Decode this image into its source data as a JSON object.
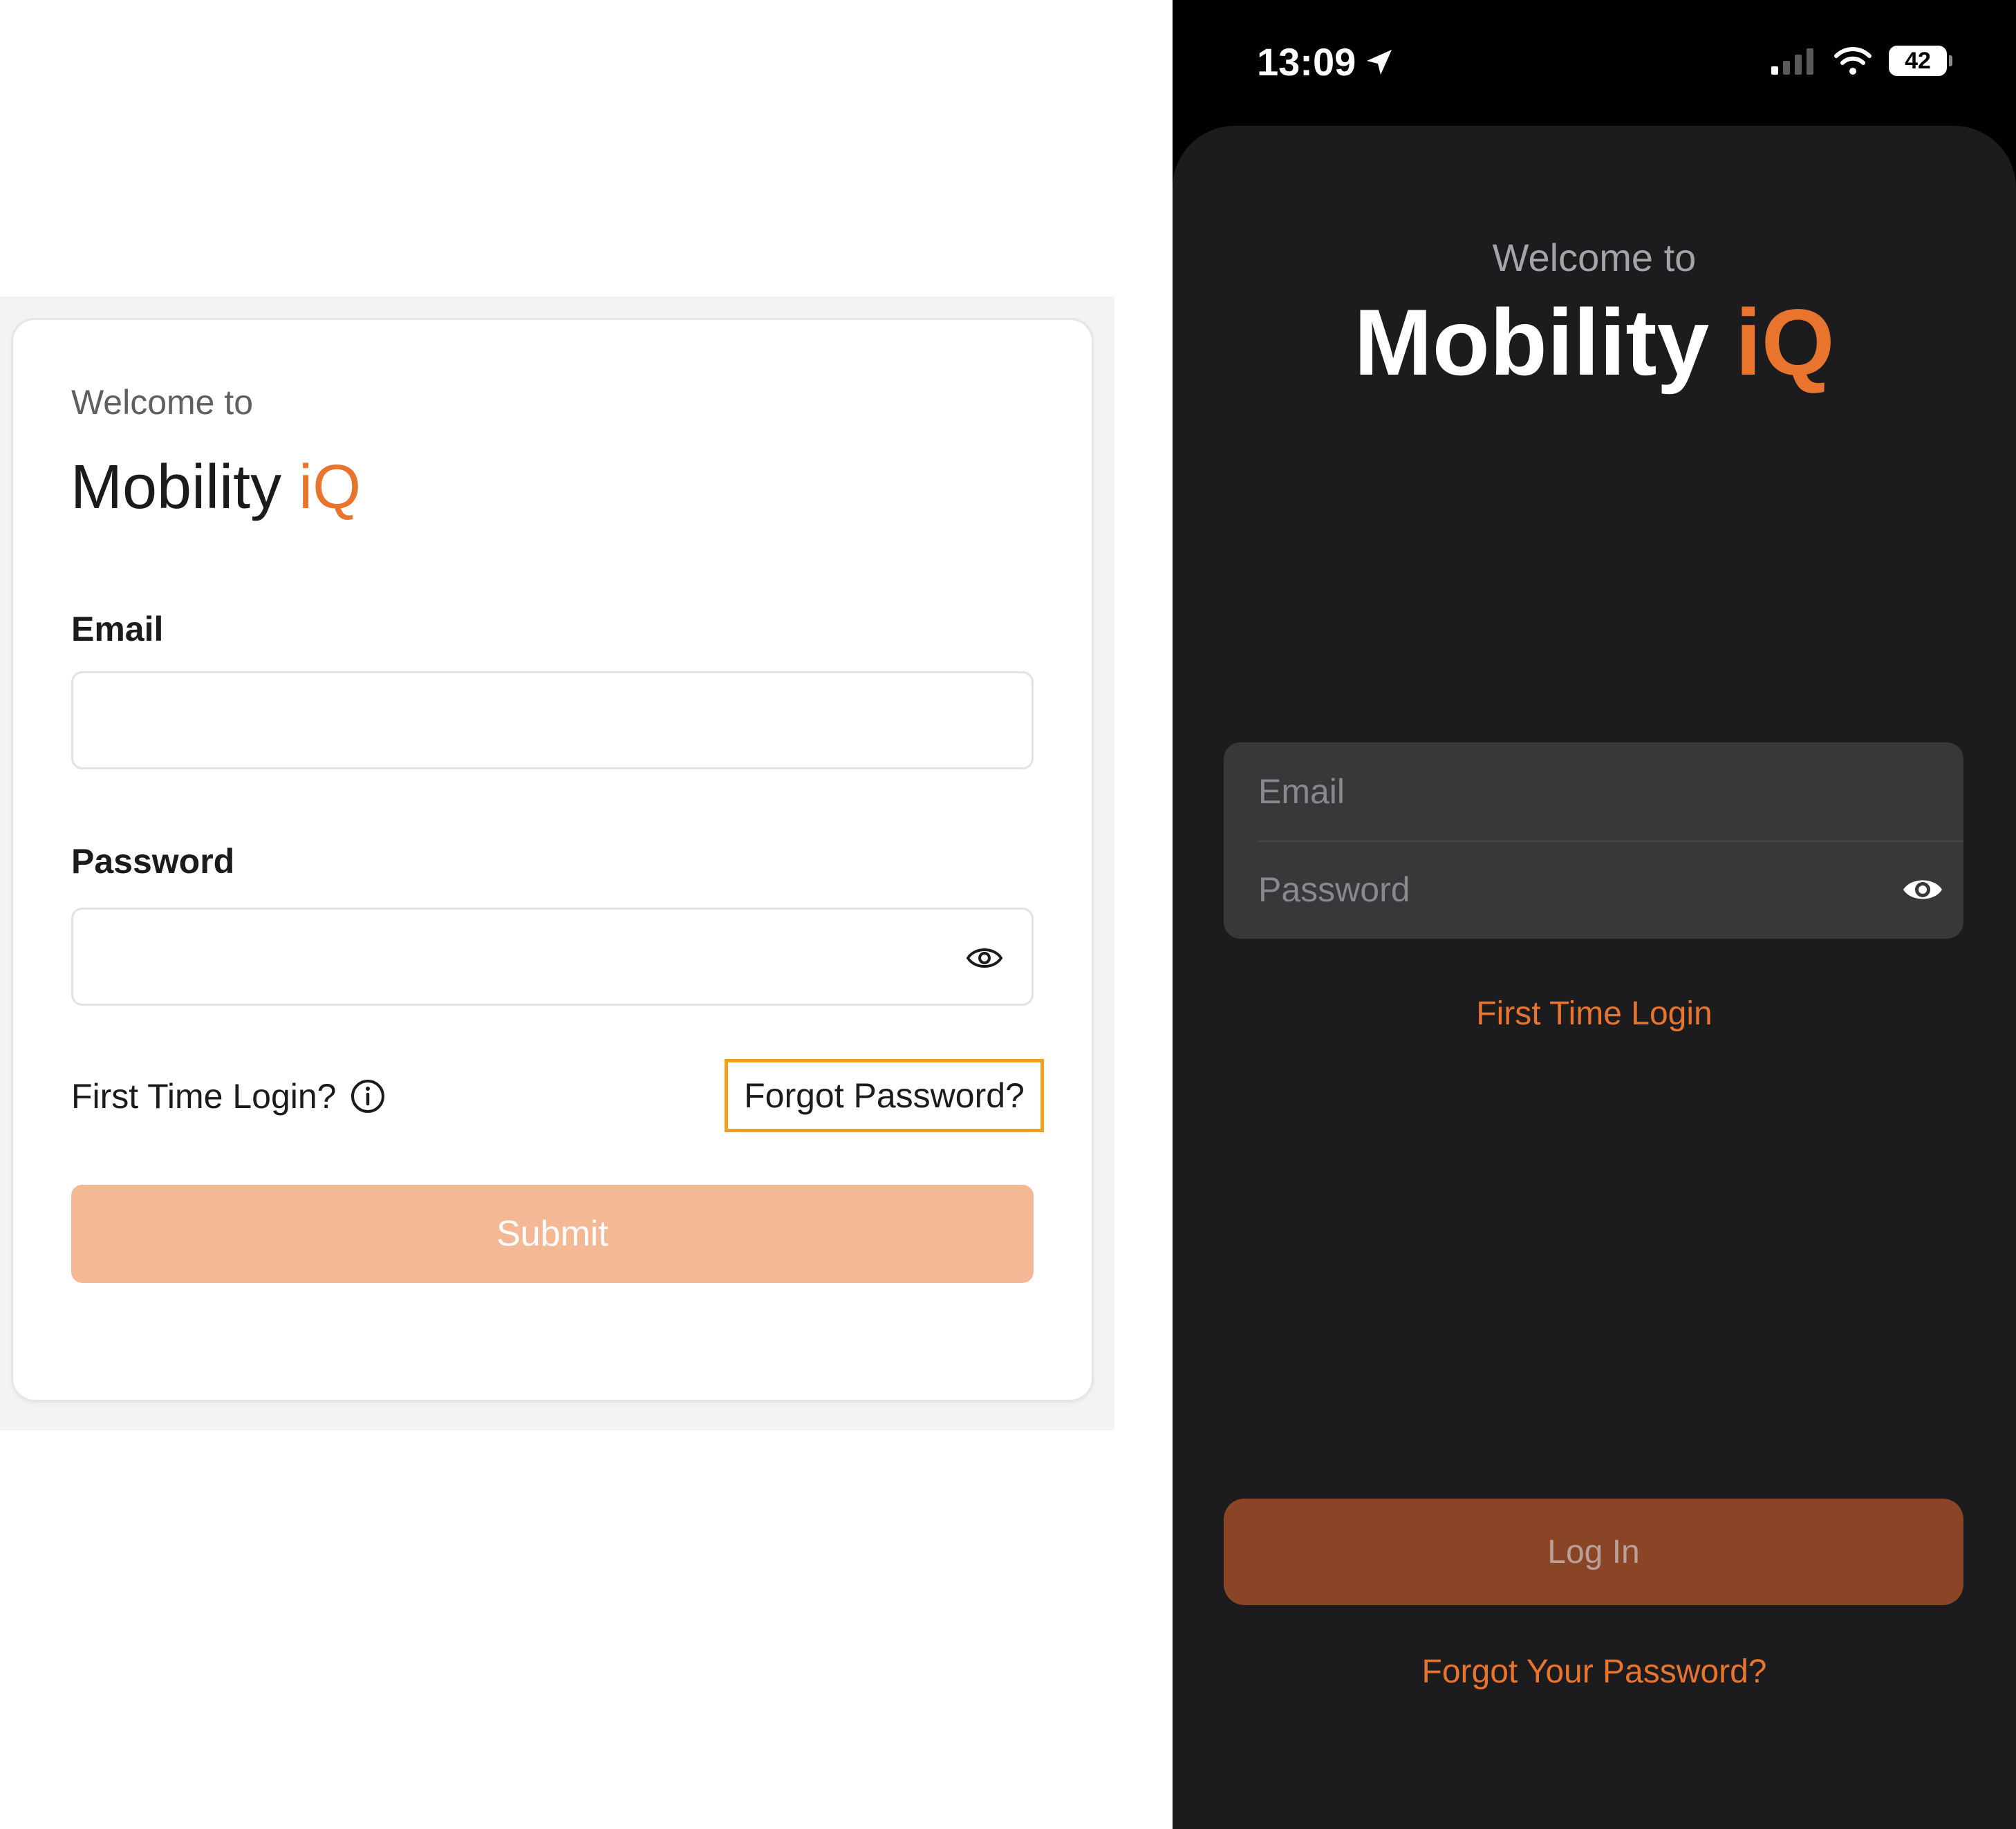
{
  "colors": {
    "brand_accent": "#e8742e",
    "web_submit_bg": "#f5b895",
    "focus_outline": "#f0a020",
    "ios_background": "#1c1c1e",
    "ios_field_bg": "#38383b",
    "ios_login_bg": "#8a4526"
  },
  "web": {
    "welcome": "Welcome to",
    "brand_name": "Mobility",
    "brand_accent": "iQ",
    "email_label": "Email",
    "email_value": "",
    "password_label": "Password",
    "password_value": "",
    "first_time_login": "First Time Login?",
    "forgot_password": "Forgot Password?",
    "submit": "Submit",
    "icons": [
      "eye-icon",
      "info-icon"
    ]
  },
  "ios": {
    "status_bar": {
      "time": "13:09",
      "battery": "42",
      "icons": [
        "location-arrow-icon",
        "cellular-signal-icon",
        "wifi-icon",
        "battery-icon"
      ]
    },
    "welcome": "Welcome to",
    "brand_name": "Mobility",
    "brand_accent": "iQ",
    "email_placeholder": "Email",
    "password_placeholder": "Password",
    "first_time_login": "First Time Login",
    "log_in": "Log In",
    "forgot_password": "Forgot Your Password?",
    "icons": [
      "eye-icon"
    ]
  }
}
